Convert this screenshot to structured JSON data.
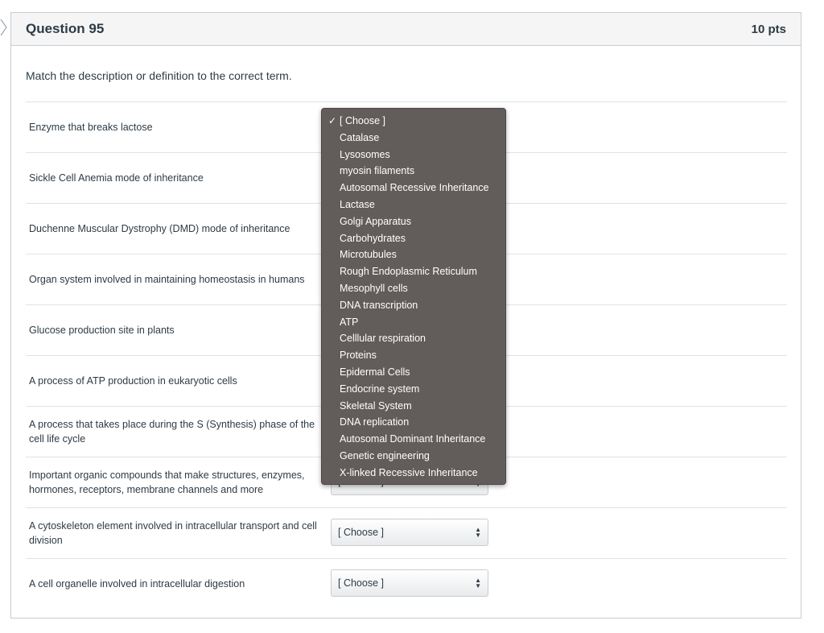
{
  "question": {
    "title": "Question 95",
    "points": "10 pts",
    "prompt": "Match the description or definition to the correct term."
  },
  "rows": [
    {
      "label": "Enzyme that breaks lactose",
      "selected": "[ Choose ]"
    },
    {
      "label": "Sickle Cell Anemia mode of inheritance",
      "selected": "[ Choose ]"
    },
    {
      "label": "Duchenne Muscular Dystrophy (DMD) mode of inheritance",
      "selected": "[ Choose ]"
    },
    {
      "label": "Organ system involved in maintaining homeostasis in humans",
      "selected": "[ Choose ]"
    },
    {
      "label": "Glucose production site in plants",
      "selected": "[ Choose ]"
    },
    {
      "label": "A process of ATP production in eukaryotic cells",
      "selected": "[ Choose ]"
    },
    {
      "label": "A process that takes place during the S (Synthesis) phase of the cell life cycle",
      "selected": "[ Choose ]"
    },
    {
      "label": "Important organic compounds that make structures, enzymes, hormones, receptors, membrane channels and more",
      "selected": "[ Choose ]"
    },
    {
      "label": "A cytoskeleton element involved in intracellular transport and cell division",
      "selected": "[ Choose ]"
    },
    {
      "label": "A cell organelle involved in intracellular digestion",
      "selected": "[ Choose ]"
    }
  ],
  "dropdown": {
    "checkmark": "✓",
    "options": [
      "[ Choose ]",
      "Catalase",
      "Lysosomes",
      "myosin filaments",
      "Autosomal Recessive Inheritance",
      "Lactase",
      "Golgi Apparatus",
      "Carbohydrates",
      "Microtubules",
      "Rough Endoplasmic Reticulum",
      "Mesophyll cells",
      "DNA transcription",
      "ATP",
      "Celllular respiration",
      "Proteins",
      "Epidermal Cells",
      "Endocrine system",
      "Skeletal System",
      "DNA replication",
      "Autosomal Dominant Inheritance",
      "Genetic engineering",
      "X-linked Recessive Inheritance"
    ]
  },
  "colors": {
    "dropdown_bg": "#625c5b",
    "header_bg": "#f5f5f5",
    "text": "#2d3b45"
  }
}
